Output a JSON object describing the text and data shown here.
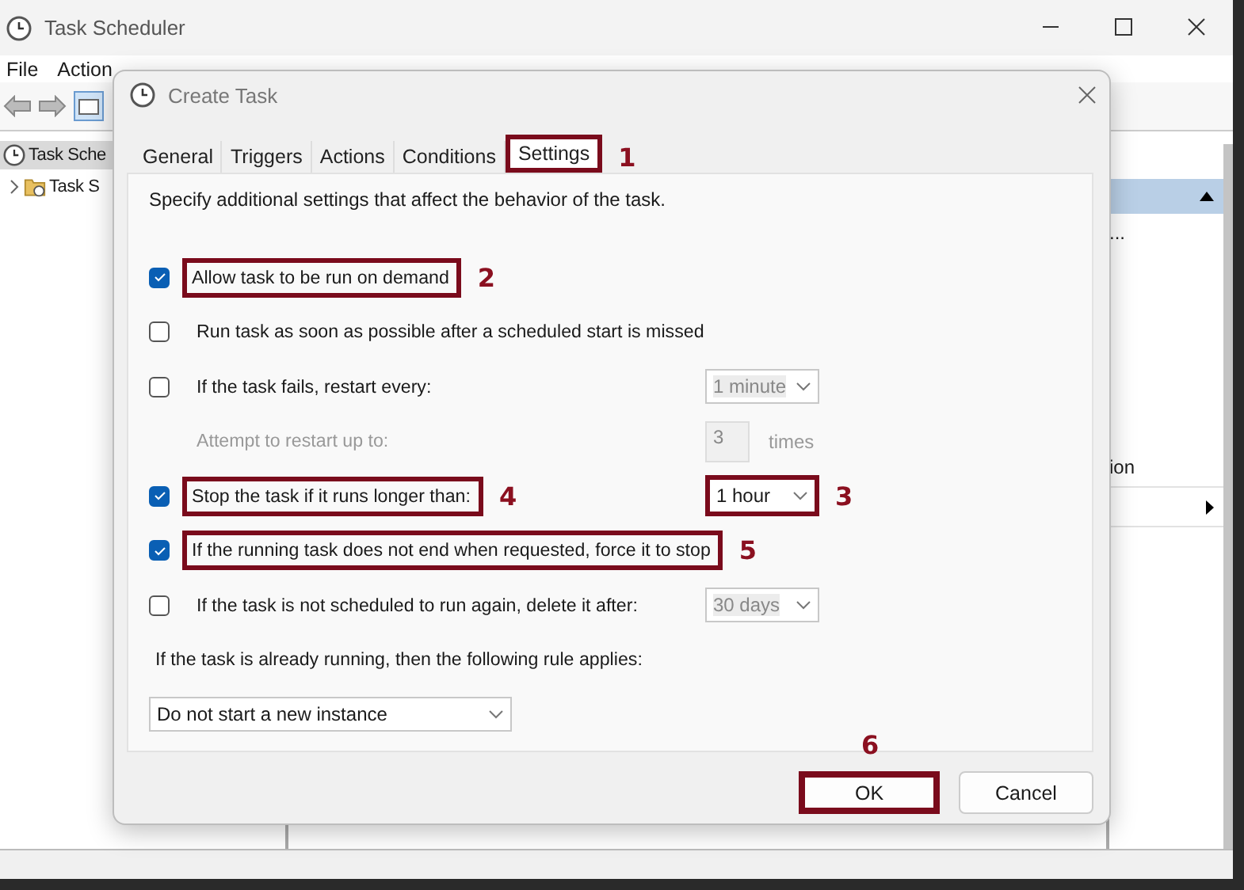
{
  "main_window": {
    "title": "Task Scheduler",
    "menu": [
      "File",
      "Action"
    ],
    "tree": [
      {
        "label": "Task Sche",
        "selected": true,
        "children": [
          {
            "label": "Task S",
            "selected": false,
            "expanded": false
          }
        ]
      }
    ],
    "actions_pane": {
      "items": [
        {
          "label": "...",
          "submenu": false
        },
        {
          "label": "ion",
          "submenu": false
        },
        {
          "submenu": true
        }
      ]
    }
  },
  "dialog": {
    "title": "Create Task",
    "tabs": [
      {
        "label": "General",
        "selected": false
      },
      {
        "label": "Triggers",
        "selected": false
      },
      {
        "label": "Actions",
        "selected": false
      },
      {
        "label": "Conditions",
        "selected": false
      },
      {
        "label": "Settings",
        "selected": true,
        "callout": "1"
      }
    ],
    "description": "Specify additional settings that affect the behavior of the task.",
    "settings": [
      {
        "kind": "checkbox",
        "label": "Allow task to be run on demand",
        "checked": true,
        "callout": "2"
      },
      {
        "kind": "checkbox",
        "label": "Run task as soon as possible after a scheduled start is missed",
        "checked": false
      },
      {
        "kind": "checkbox",
        "label": "If the task fails, restart every:",
        "checked": false,
        "select": {
          "value": "1 minute",
          "disabled": true
        }
      },
      {
        "kind": "count",
        "label": "Attempt to restart up to:",
        "disabled": true,
        "field": {
          "value": "3",
          "disabled": true
        },
        "unit": "times"
      },
      {
        "kind": "checkbox",
        "label": "Stop the task if it runs longer than:",
        "checked": true,
        "callout": "4",
        "select": {
          "value": "1 hour",
          "disabled": false,
          "callout": "3"
        }
      },
      {
        "kind": "checkbox",
        "label": "If the running task does not end when requested, force it to stop",
        "checked": true,
        "callout": "5"
      },
      {
        "kind": "checkbox",
        "label": "If the task is not scheduled to run again, delete it after:",
        "checked": false,
        "select": {
          "value": "30 days",
          "disabled": true
        }
      },
      {
        "kind": "note",
        "label": "If the task is already running, then the following rule applies:"
      },
      {
        "kind": "select",
        "select": {
          "value": "Do not start a new instance",
          "disabled": false
        }
      }
    ],
    "buttons": [
      {
        "label": "OK",
        "callout": "6"
      },
      {
        "label": "Cancel"
      }
    ]
  }
}
